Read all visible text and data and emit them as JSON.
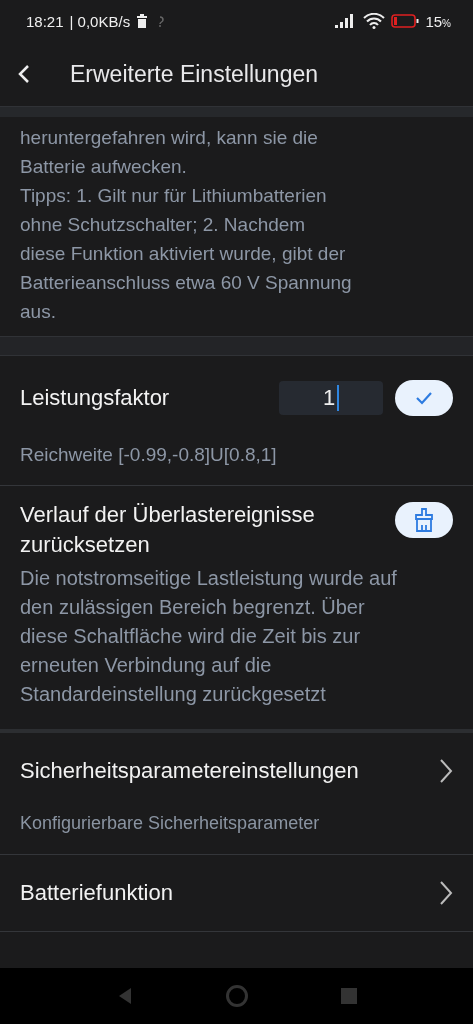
{
  "status_bar": {
    "time": "18:21",
    "network": "| 0,0KB/s",
    "battery_percent": "15",
    "battery_unit": "%",
    "battery_low": true
  },
  "header": {
    "title": "Erweiterte Einstellungen"
  },
  "notice": {
    "text": "heruntergefahren wird, kann sie die\nBatterie aufwecken.\nTipps: 1. Gilt nur für Lithiumbatterien\nohne Schutzschalter; 2. Nachdem\ndiese Funktion aktiviert wurde, gibt der\nBatterieanschluss etwa 60 V Spannung\naus."
  },
  "settings": [
    {
      "kind": "input",
      "label": "Leistungsfaktor",
      "value": "1",
      "focused": true,
      "hint": "Reichweite [-0.99,-0.8]U[0.8,1]"
    },
    {
      "kind": "action",
      "label": "Verlauf der Überlastereignisse zurücksetzen",
      "hint": "Die notstromseitige Lastleistung wurde auf den zulässigen Bereich begrenzt. Über diese Schaltfläche wird die Zeit bis zur erneuten Verbindung auf die Standardeinstellung zurückgesetzt"
    },
    {
      "kind": "link",
      "label": "Sicherheitsparametereinstellungen",
      "hint": "Konfigurierbare Sicherheitsparameter"
    },
    {
      "kind": "link",
      "label": "Batteriefunktion"
    }
  ]
}
